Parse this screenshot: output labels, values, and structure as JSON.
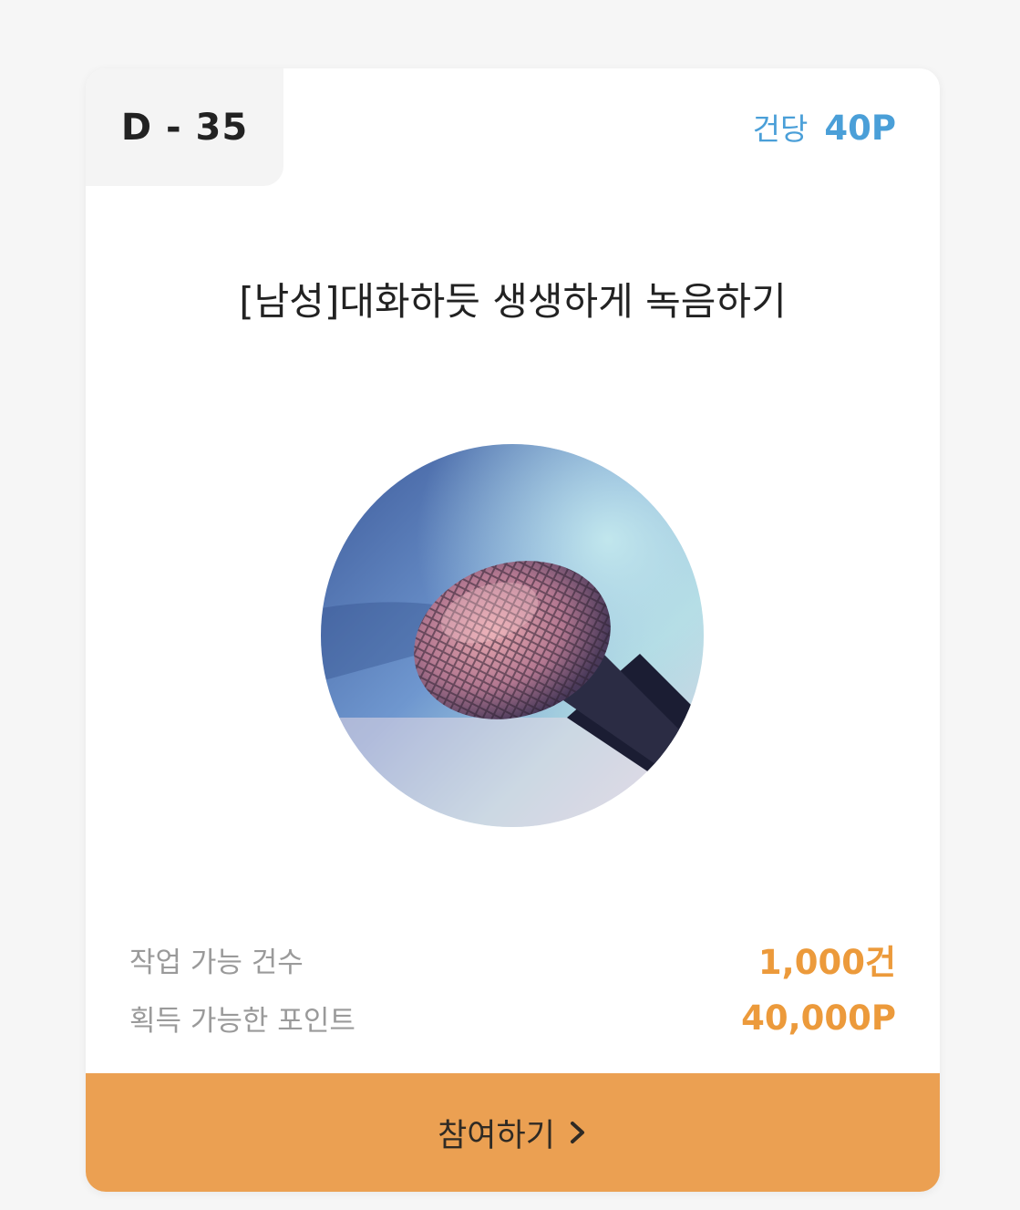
{
  "card": {
    "dday": "D - 35",
    "per_item_label": "건당",
    "per_item_value": "40P",
    "title": "[남성]대화하듯 생생하게 녹음하기",
    "image_icon": "microphone-photo",
    "stats": [
      {
        "label": "작업 가능 건수",
        "value": "1,000건"
      },
      {
        "label": "획득 가능한 포인트",
        "value": "40,000P"
      }
    ],
    "cta_label": "참여하기",
    "cta_icon": "chevron-right-icon"
  },
  "colors": {
    "accent_orange": "#eba052",
    "value_orange": "#ec9a3b",
    "point_blue": "#4a9fd8"
  }
}
